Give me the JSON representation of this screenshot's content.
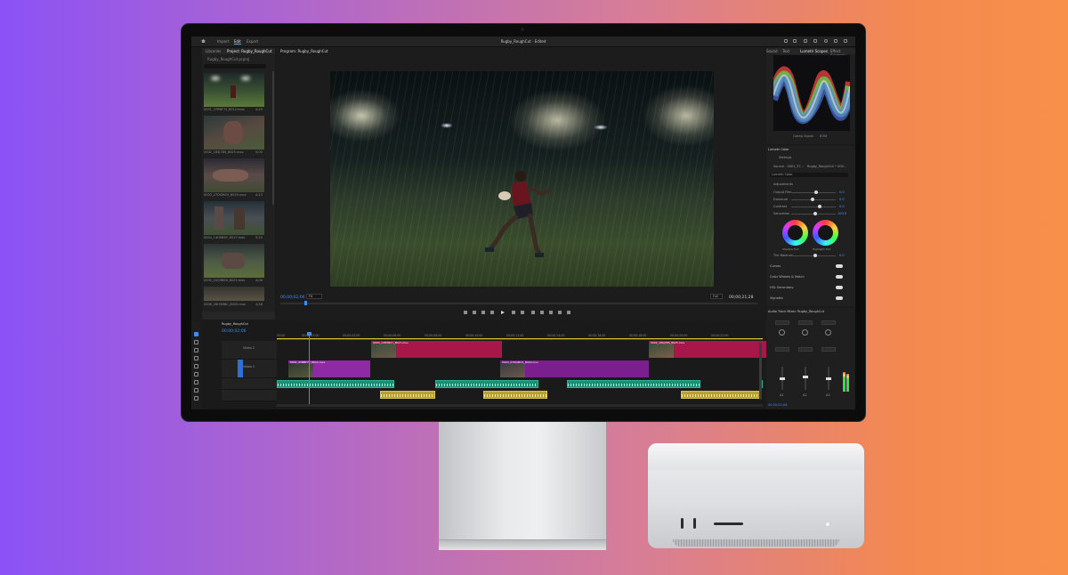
{
  "app": {
    "title": "Rugby_RoughCut - Edited",
    "workspace_tabs": [
      "Import",
      "Edit",
      "Export"
    ],
    "active_workspace": "Edit"
  },
  "project_panel": {
    "tabs": [
      "Libraries",
      "Project: Rugby_RoughCut"
    ],
    "path": "Rugby_RoughCut.prproj",
    "clips": [
      {
        "name": "0001_37RBF72_8012.mov",
        "dur": "4;29"
      },
      {
        "name": "0002_18SJ7B5_8025.mov",
        "dur": "5;00"
      },
      {
        "name": "0003_27DQMC5_8019.mov",
        "dur": "4;13"
      },
      {
        "name": "0004_14H0BXY_8017.mov",
        "dur": "3;20"
      },
      {
        "name": "0005_24Q3BE0_8023.mov",
        "dur": "4;06"
      },
      {
        "name": "0006_28H3M8C_8020.mov",
        "dur": "4;28"
      }
    ]
  },
  "program_monitor": {
    "title": "Program: Rugby_RoughCut",
    "timecode_current": "00;00;02;06",
    "timecode_duration": "00;00;21;28",
    "fit": "Fit",
    "resolution": "Full"
  },
  "scopes": {
    "tabs": [
      "Sound",
      "Text",
      "Lumetri Scopes",
      "Effect Controls"
    ],
    "active_tab": "Lumetri Scopes",
    "clamp_label": "Clamp Signal",
    "bit_depth": "8 Bit"
  },
  "lumetri": {
    "title": "Lumetri Color",
    "settings_label": "Settings",
    "source": "Source - 0001_37...",
    "target": "Rugby_RoughCut • 000...",
    "look_label": "Lumetri Color",
    "adjustments_label": "Adjustments",
    "sliders": [
      {
        "label": "Vibrance",
        "value": "0.0",
        "pos": 0.5
      },
      {
        "label": "Saturation",
        "value": "100.0",
        "pos": 0.5
      },
      {
        "label": "Tint Balance",
        "value": "0.0",
        "pos": 0.5
      }
    ],
    "wheels": {
      "shadow": "Shadow Tint",
      "highlight": "Highlight Tint"
    },
    "basic": [
      {
        "label": "Output Film",
        "value": "0.0",
        "pos": 0.52
      },
      {
        "label": "Exposure",
        "value": "0.0",
        "pos": 0.45
      },
      {
        "label": "Contrast",
        "value": "0.0",
        "pos": 0.6
      },
      {
        "label": "Saturation",
        "value": "100.0",
        "pos": 0.5
      }
    ],
    "sections": [
      "Curves",
      "Color Wheels & Match",
      "HSL Secondary",
      "Vignette"
    ]
  },
  "timeline": {
    "sequence_title": "Rugby_RoughCut",
    "timecode": "00;00;02;06",
    "ruler": [
      "00;00",
      "00;00;02;00",
      "00;00;04;00",
      "00;00;06;00",
      "00;00;08;00",
      "00;00;10;00",
      "00;00;12;00",
      "00;00;14;00",
      "00;00;16;00",
      "00;00;18;00",
      "00;00;20;00",
      "00;00;22;00"
    ],
    "tracks": [
      {
        "id": "V2",
        "name": "Video 2"
      },
      {
        "id": "V1",
        "name": "Video 1"
      },
      {
        "id": "A1",
        "name": ""
      },
      {
        "id": "A2",
        "name": ""
      }
    ],
    "clips_v2": [
      {
        "name": "0004_14H0BXY_8017.mov",
        "color": "#b0194a"
      },
      {
        "name": "0002_18SJ7B5_8025.mov",
        "color": "#b0194a"
      }
    ],
    "clips_v1": [
      {
        "name": "0001_37RBF72_8012.mov",
        "color": "#8b2aa2"
      },
      {
        "name": "0003_27DQMC5_8019.mov",
        "color": "#8b2aa2"
      }
    ]
  },
  "mixer": {
    "title": "Audio Track Mixer: Rugby_RoughCut",
    "channels": [
      "A1",
      "A2",
      "A3"
    ],
    "read": "Read",
    "timecode": "00;00;02;06"
  }
}
